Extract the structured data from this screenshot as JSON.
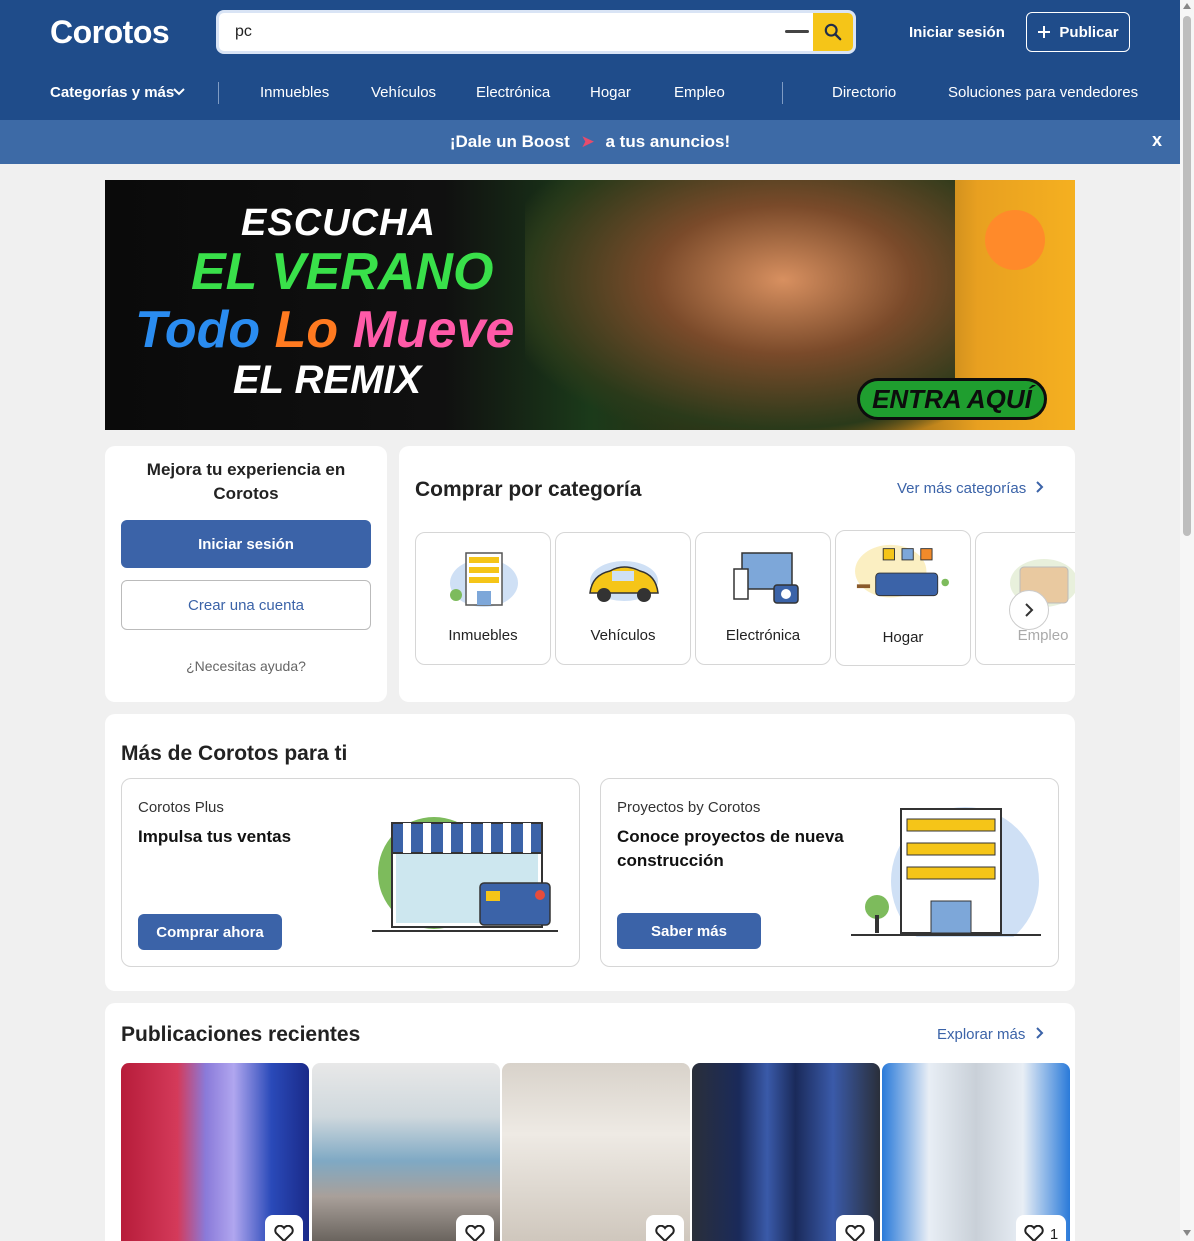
{
  "header": {
    "logo": "Corotos",
    "search_value": "pc",
    "login": "Iniciar sesión",
    "publish": "Publicar"
  },
  "nav": {
    "categories": "Categorías y más",
    "items": [
      "Inmuebles",
      "Vehículos",
      "Electrónica",
      "Hogar",
      "Empleo"
    ],
    "directory": "Directorio",
    "solutions": "Soluciones para vendedores"
  },
  "boost": {
    "text_before": "¡Dale un Boost",
    "text_after": "a tus anuncios!",
    "close": "x"
  },
  "promo": {
    "line1": "ESCUCHA",
    "line2": "EL VERANO",
    "line3a": "Todo",
    "line3b": "Lo",
    "line3c": "Mueve",
    "line4": "EL REMIX",
    "cta": "ENTRA AQUÍ"
  },
  "login_card": {
    "title": "Mejora tu experiencia en Corotos",
    "login": "Iniciar sesión",
    "create": "Crear una cuenta",
    "help": "¿Necesitas ayuda?"
  },
  "categories_card": {
    "title": "Comprar por categoría",
    "more": "Ver más categorías",
    "tiles": [
      "Inmuebles",
      "Vehículos",
      "Electrónica",
      "Hogar",
      "Empleo"
    ]
  },
  "more_section": {
    "title": "Más de Corotos para ti",
    "plus": {
      "eyebrow": "Corotos Plus",
      "heading": "Impulsa tus ventas",
      "button": "Comprar ahora"
    },
    "projects": {
      "eyebrow": "Proyectos by Corotos",
      "heading": "Conoce proyectos de nueva construcción",
      "button": "Saber más"
    }
  },
  "recent": {
    "title": "Publicaciones recientes",
    "more": "Explorar más",
    "last_count": "1"
  },
  "colors": {
    "brand_blue": "#1f4c8a",
    "button_blue": "#3b63a8",
    "search_yellow": "#f5c518"
  }
}
